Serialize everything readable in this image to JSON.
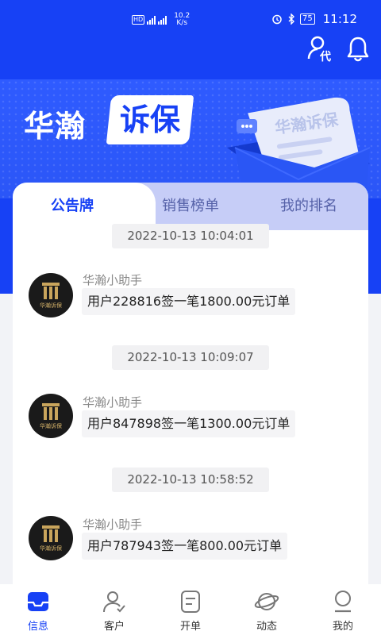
{
  "status_bar": {
    "network": "HD",
    "speed_value": "10.2",
    "speed_unit": "K/s",
    "battery": "75",
    "time": "11:12"
  },
  "header": {
    "agent_icon": "user-agent-icon",
    "agent_label": "代",
    "bell_icon": "bell-icon"
  },
  "banner": {
    "brand_left": "华瀚",
    "brand_right": "诉保",
    "illustration_text": "华瀚诉保"
  },
  "tabs": [
    {
      "label": "公告牌",
      "active": true
    },
    {
      "label": "销售榜单",
      "active": false
    },
    {
      "label": "我的排名",
      "active": false
    }
  ],
  "messages": [
    {
      "time": "2022-10-13 10:04:01",
      "sender": "华瀚小助手",
      "text": "用户228816签一笔1800.00元订单",
      "avatar_text": "华瀚诉保"
    },
    {
      "time": "2022-10-13 10:09:07",
      "sender": "华瀚小助手",
      "text": "用户847898签一笔1300.00元订单",
      "avatar_text": "华瀚诉保"
    },
    {
      "time": "2022-10-13 10:58:52",
      "sender": "华瀚小助手",
      "text": "用户787943签一笔800.00元订单",
      "avatar_text": "华瀚诉保"
    }
  ],
  "bottom_nav": [
    {
      "label": "信息",
      "icon": "inbox-icon",
      "active": true
    },
    {
      "label": "客户",
      "icon": "customer-icon",
      "active": false
    },
    {
      "label": "开单",
      "icon": "order-icon",
      "active": false
    },
    {
      "label": "动态",
      "icon": "planet-icon",
      "active": false
    },
    {
      "label": "我的",
      "icon": "profile-icon",
      "active": false
    }
  ],
  "colors": {
    "primary": "#1741f5",
    "tab_inactive_bg": "#c6cdf7",
    "page_bg": "#f2f3f7"
  }
}
